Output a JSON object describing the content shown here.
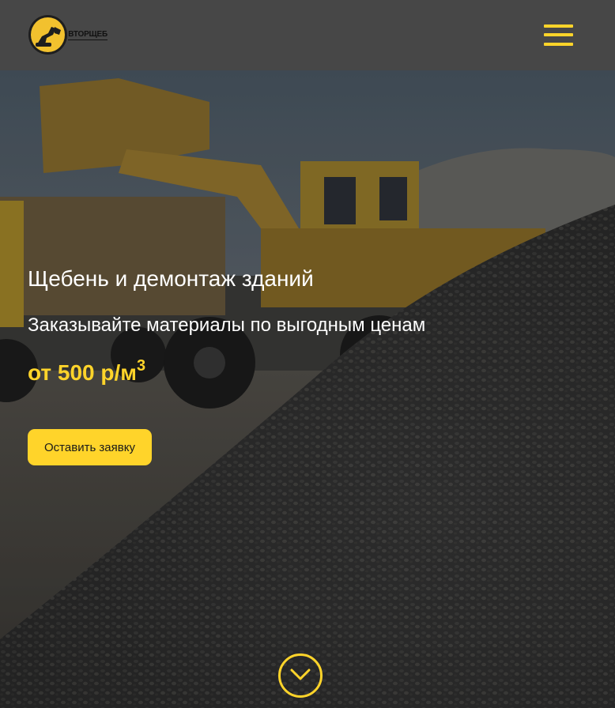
{
  "header": {
    "logo_text": "ВТОРЩЕБ",
    "logo_icon": "excavator-logo-icon",
    "menu_icon": "hamburger-menu-icon"
  },
  "hero": {
    "title": "Щебень и демонтаж зданий",
    "subtitle": "Заказывайте материалы по выгодным ценам",
    "price_prefix": "от 500 р/м",
    "price_sup": "3",
    "cta_label": "Оставить заявку",
    "scroll_icon": "chevron-down-circle-icon"
  },
  "colors": {
    "accent": "#ffd42a",
    "header_bg": "#474747",
    "text": "#ffffff"
  }
}
